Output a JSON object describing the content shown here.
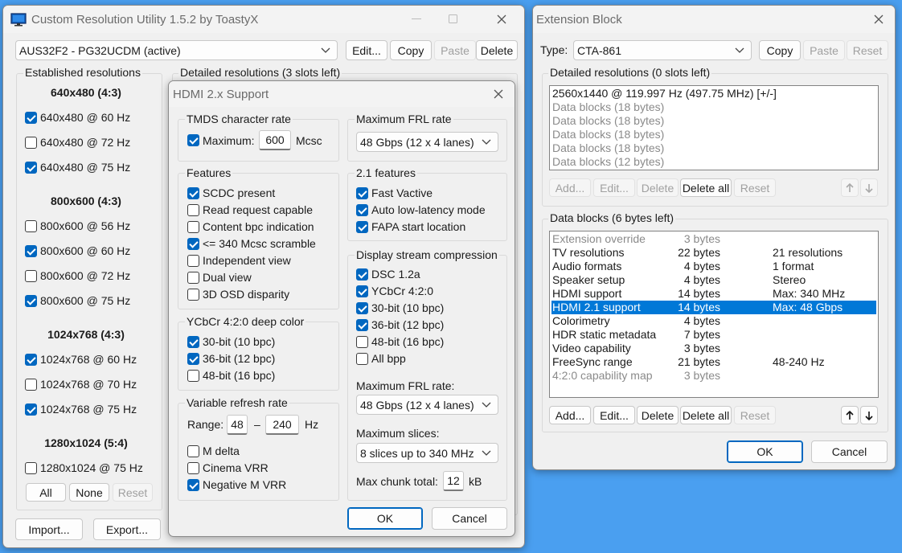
{
  "cru": {
    "title": "Custom Resolution Utility 1.5.2 by ToastyX",
    "monitor": "AUS32F2 - PG32UCDM (active)",
    "buttons": {
      "edit": "Edit...",
      "copy": "Copy",
      "paste": "Paste",
      "delete": "Delete"
    },
    "established_title": "Established resolutions",
    "detailed_title": "Detailed resolutions (3 slots left)",
    "groups": [
      {
        "heading": "640x480 (4:3)",
        "items": [
          {
            "label": "640x480 @ 60 Hz",
            "checked": true
          },
          {
            "label": "640x480 @ 72 Hz",
            "checked": false
          },
          {
            "label": "640x480 @ 75 Hz",
            "checked": true
          }
        ]
      },
      {
        "heading": "800x600 (4:3)",
        "items": [
          {
            "label": "800x600 @ 56 Hz",
            "checked": false
          },
          {
            "label": "800x600 @ 60 Hz",
            "checked": true
          },
          {
            "label": "800x600 @ 72 Hz",
            "checked": false
          },
          {
            "label": "800x600 @ 75 Hz",
            "checked": true
          }
        ]
      },
      {
        "heading": "1024x768 (4:3)",
        "items": [
          {
            "label": "1024x768 @ 60 Hz",
            "checked": true
          },
          {
            "label": "1024x768 @ 70 Hz",
            "checked": false
          },
          {
            "label": "1024x768 @ 75 Hz",
            "checked": true
          }
        ]
      },
      {
        "heading": "1280x1024 (5:4)",
        "items": [
          {
            "label": "1280x1024 @ 75 Hz",
            "checked": false
          }
        ]
      }
    ],
    "all": "All",
    "none": "None",
    "reset": "Reset",
    "import": "Import...",
    "export": "Export..."
  },
  "hdmi": {
    "title": "HDMI 2.x Support",
    "tmds_title": "TMDS character rate",
    "maximum_label": "Maximum:",
    "maximum_checked": true,
    "maximum_value": "600",
    "maximum_unit": "Mcsc",
    "features_title": "Features",
    "features": [
      {
        "label": "SCDC present",
        "checked": true
      },
      {
        "label": "Read request capable",
        "checked": false
      },
      {
        "label": "Content bpc indication",
        "checked": false
      },
      {
        "label": "<= 340 Mcsc scramble",
        "checked": true
      },
      {
        "label": "Independent view",
        "checked": false
      },
      {
        "label": "Dual view",
        "checked": false
      },
      {
        "label": "3D OSD disparity",
        "checked": false
      }
    ],
    "ycbcr_title": "YCbCr 4:2:0 deep color",
    "ycbcr": [
      {
        "label": "30-bit (10 bpc)",
        "checked": true
      },
      {
        "label": "36-bit (12 bpc)",
        "checked": true
      },
      {
        "label": "48-bit (16 bpc)",
        "checked": false
      }
    ],
    "vrr_title": "Variable refresh rate",
    "range_label": "Range:",
    "range_min": "48",
    "range_dash": "–",
    "range_max": "240",
    "range_unit": "Hz",
    "vrr": [
      {
        "label": "M delta",
        "checked": false
      },
      {
        "label": "Cinema VRR",
        "checked": false
      },
      {
        "label": "Negative M VRR",
        "checked": true
      }
    ],
    "frl_title": "Maximum FRL rate",
    "frl_value": "48 Gbps (12 x 4 lanes)",
    "f21_title": "2.1 features",
    "f21": [
      {
        "label": "Fast Vactive",
        "checked": true
      },
      {
        "label": "Auto low-latency mode",
        "checked": true
      },
      {
        "label": "FAPA start location",
        "checked": true
      }
    ],
    "dsc_title": "Display stream compression",
    "dsc": [
      {
        "label": "DSC 1.2a",
        "checked": true
      },
      {
        "label": "YCbCr 4:2:0",
        "checked": true
      },
      {
        "label": "30-bit (10 bpc)",
        "checked": true
      },
      {
        "label": "36-bit (12 bpc)",
        "checked": true
      },
      {
        "label": "48-bit (16 bpc)",
        "checked": false
      },
      {
        "label": "All bpp",
        "checked": false
      }
    ],
    "dsc_frl_label": "Maximum FRL rate:",
    "dsc_frl_value": "48 Gbps (12 x 4 lanes)",
    "slices_label": "Maximum slices:",
    "slices_value": "8 slices up to 340 MHz",
    "chunk_label": "Max chunk total:",
    "chunk_value": "12",
    "chunk_unit": "kB",
    "ok": "OK",
    "cancel": "Cancel"
  },
  "ext": {
    "title": "Extension Block",
    "type_label": "Type:",
    "type_value": "CTA-861",
    "copy": "Copy",
    "paste": "Paste",
    "reset": "Reset",
    "detailed_title": "Detailed resolutions (0 slots left)",
    "detailed": [
      {
        "text": "2560x1440 @ 119.997 Hz (497.75 MHz) [+/-]",
        "grey": false
      },
      {
        "text": "Data blocks (18 bytes)",
        "grey": true
      },
      {
        "text": "Data blocks (18 bytes)",
        "grey": true
      },
      {
        "text": "Data blocks (18 bytes)",
        "grey": true
      },
      {
        "text": "Data blocks (18 bytes)",
        "grey": true
      },
      {
        "text": "Data blocks (12 bytes)",
        "grey": true
      }
    ],
    "det_buttons": {
      "add": "Add...",
      "edit": "Edit...",
      "delete": "Delete",
      "delete_all": "Delete all",
      "reset": "Reset"
    },
    "blocks_title": "Data blocks (6 bytes left)",
    "blocks": [
      {
        "name": "Extension override",
        "bytes": "3 bytes",
        "info": "",
        "grey": true,
        "sel": false
      },
      {
        "name": "TV resolutions",
        "bytes": "22 bytes",
        "info": "21 resolutions",
        "grey": false,
        "sel": false
      },
      {
        "name": "Audio formats",
        "bytes": "4 bytes",
        "info": "1 format",
        "grey": false,
        "sel": false
      },
      {
        "name": "Speaker setup",
        "bytes": "4 bytes",
        "info": "Stereo",
        "grey": false,
        "sel": false
      },
      {
        "name": "HDMI support",
        "bytes": "14 bytes",
        "info": "Max: 340 MHz",
        "grey": false,
        "sel": false
      },
      {
        "name": "HDMI 2.1 support",
        "bytes": "14 bytes",
        "info": "Max: 48 Gbps",
        "grey": false,
        "sel": true
      },
      {
        "name": "Colorimetry",
        "bytes": "4 bytes",
        "info": "",
        "grey": false,
        "sel": false
      },
      {
        "name": "HDR static metadata",
        "bytes": "7 bytes",
        "info": "",
        "grey": false,
        "sel": false
      },
      {
        "name": "Video capability",
        "bytes": "3 bytes",
        "info": "",
        "grey": false,
        "sel": false
      },
      {
        "name": "FreeSync range",
        "bytes": "21 bytes",
        "info": "48-240 Hz",
        "grey": false,
        "sel": false
      },
      {
        "name": "4:2:0 capability map",
        "bytes": "3 bytes",
        "info": "",
        "grey": true,
        "sel": false
      }
    ],
    "blk_buttons": {
      "add": "Add...",
      "edit": "Edit...",
      "delete": "Delete",
      "delete_all": "Delete all",
      "reset": "Reset"
    },
    "ok": "OK",
    "cancel": "Cancel"
  },
  "colors": {
    "accent": "#0067c0",
    "selection": "#0078d7",
    "desktop": "#4a9ff0"
  }
}
